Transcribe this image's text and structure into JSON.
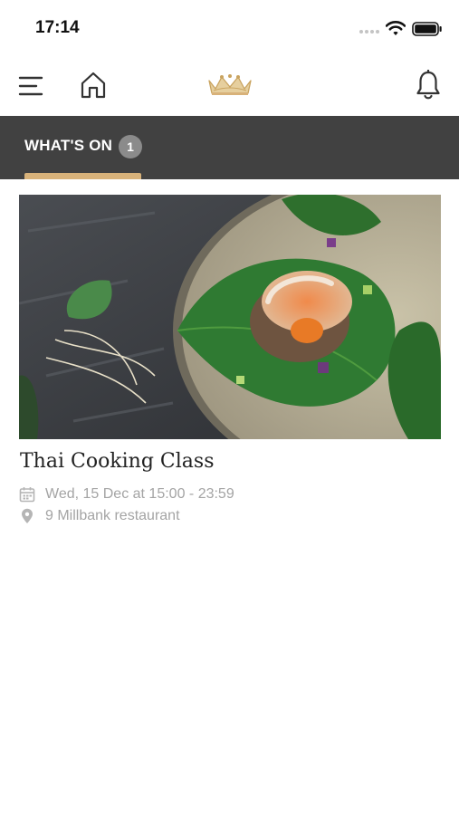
{
  "status_bar": {
    "time": "17:14",
    "icons": [
      "signal-dots",
      "wifi-icon",
      "battery-icon"
    ]
  },
  "nav": {
    "icons": [
      "menu-icon",
      "home-icon",
      "crown-logo-icon",
      "bell-icon"
    ],
    "accent_color": "#d8b27a"
  },
  "tabs": [
    {
      "label": "WHAT'S ON",
      "badge": "1",
      "selected": true
    }
  ],
  "events": [
    {
      "title": "Thai Cooking Class",
      "date": "Wed, 15 Dec at 15:00 - 23:59",
      "location": "9 Millbank restaurant",
      "date_icon": "calendar-icon",
      "location_icon": "location-pin-icon"
    }
  ],
  "colors": {
    "tab_bar_bg": "#414141",
    "badge_bg": "#8b8b8b",
    "meta_text": "#a4a4a4"
  }
}
